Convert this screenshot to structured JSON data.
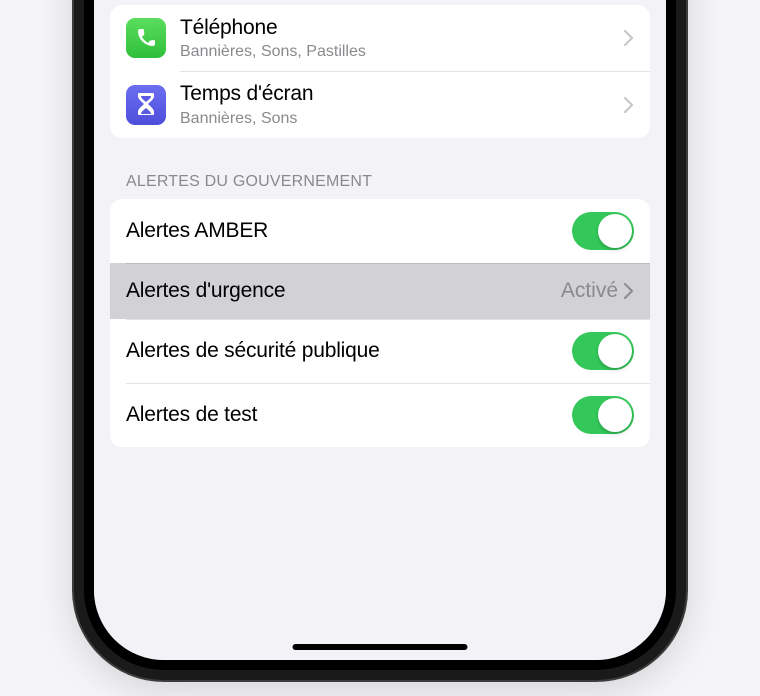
{
  "apps": [
    {
      "name": "Téléphone",
      "subtitle": "Bannières, Sons, Pastilles",
      "icon": "phone",
      "icon_color": "green"
    },
    {
      "name": "Temps d'écran",
      "subtitle": "Bannières, Sons",
      "icon": "hourglass",
      "icon_color": "purple"
    }
  ],
  "gov_section": {
    "header": "ALERTES DU GOUVERNEMENT",
    "rows": [
      {
        "label": "Alertes AMBER",
        "type": "toggle",
        "value": true
      },
      {
        "label": "Alertes d'urgence",
        "type": "link",
        "detail": "Activé",
        "highlighted": true
      },
      {
        "label": "Alertes de sécurité publique",
        "type": "toggle",
        "value": true
      },
      {
        "label": "Alertes de test",
        "type": "toggle",
        "value": true
      }
    ]
  }
}
